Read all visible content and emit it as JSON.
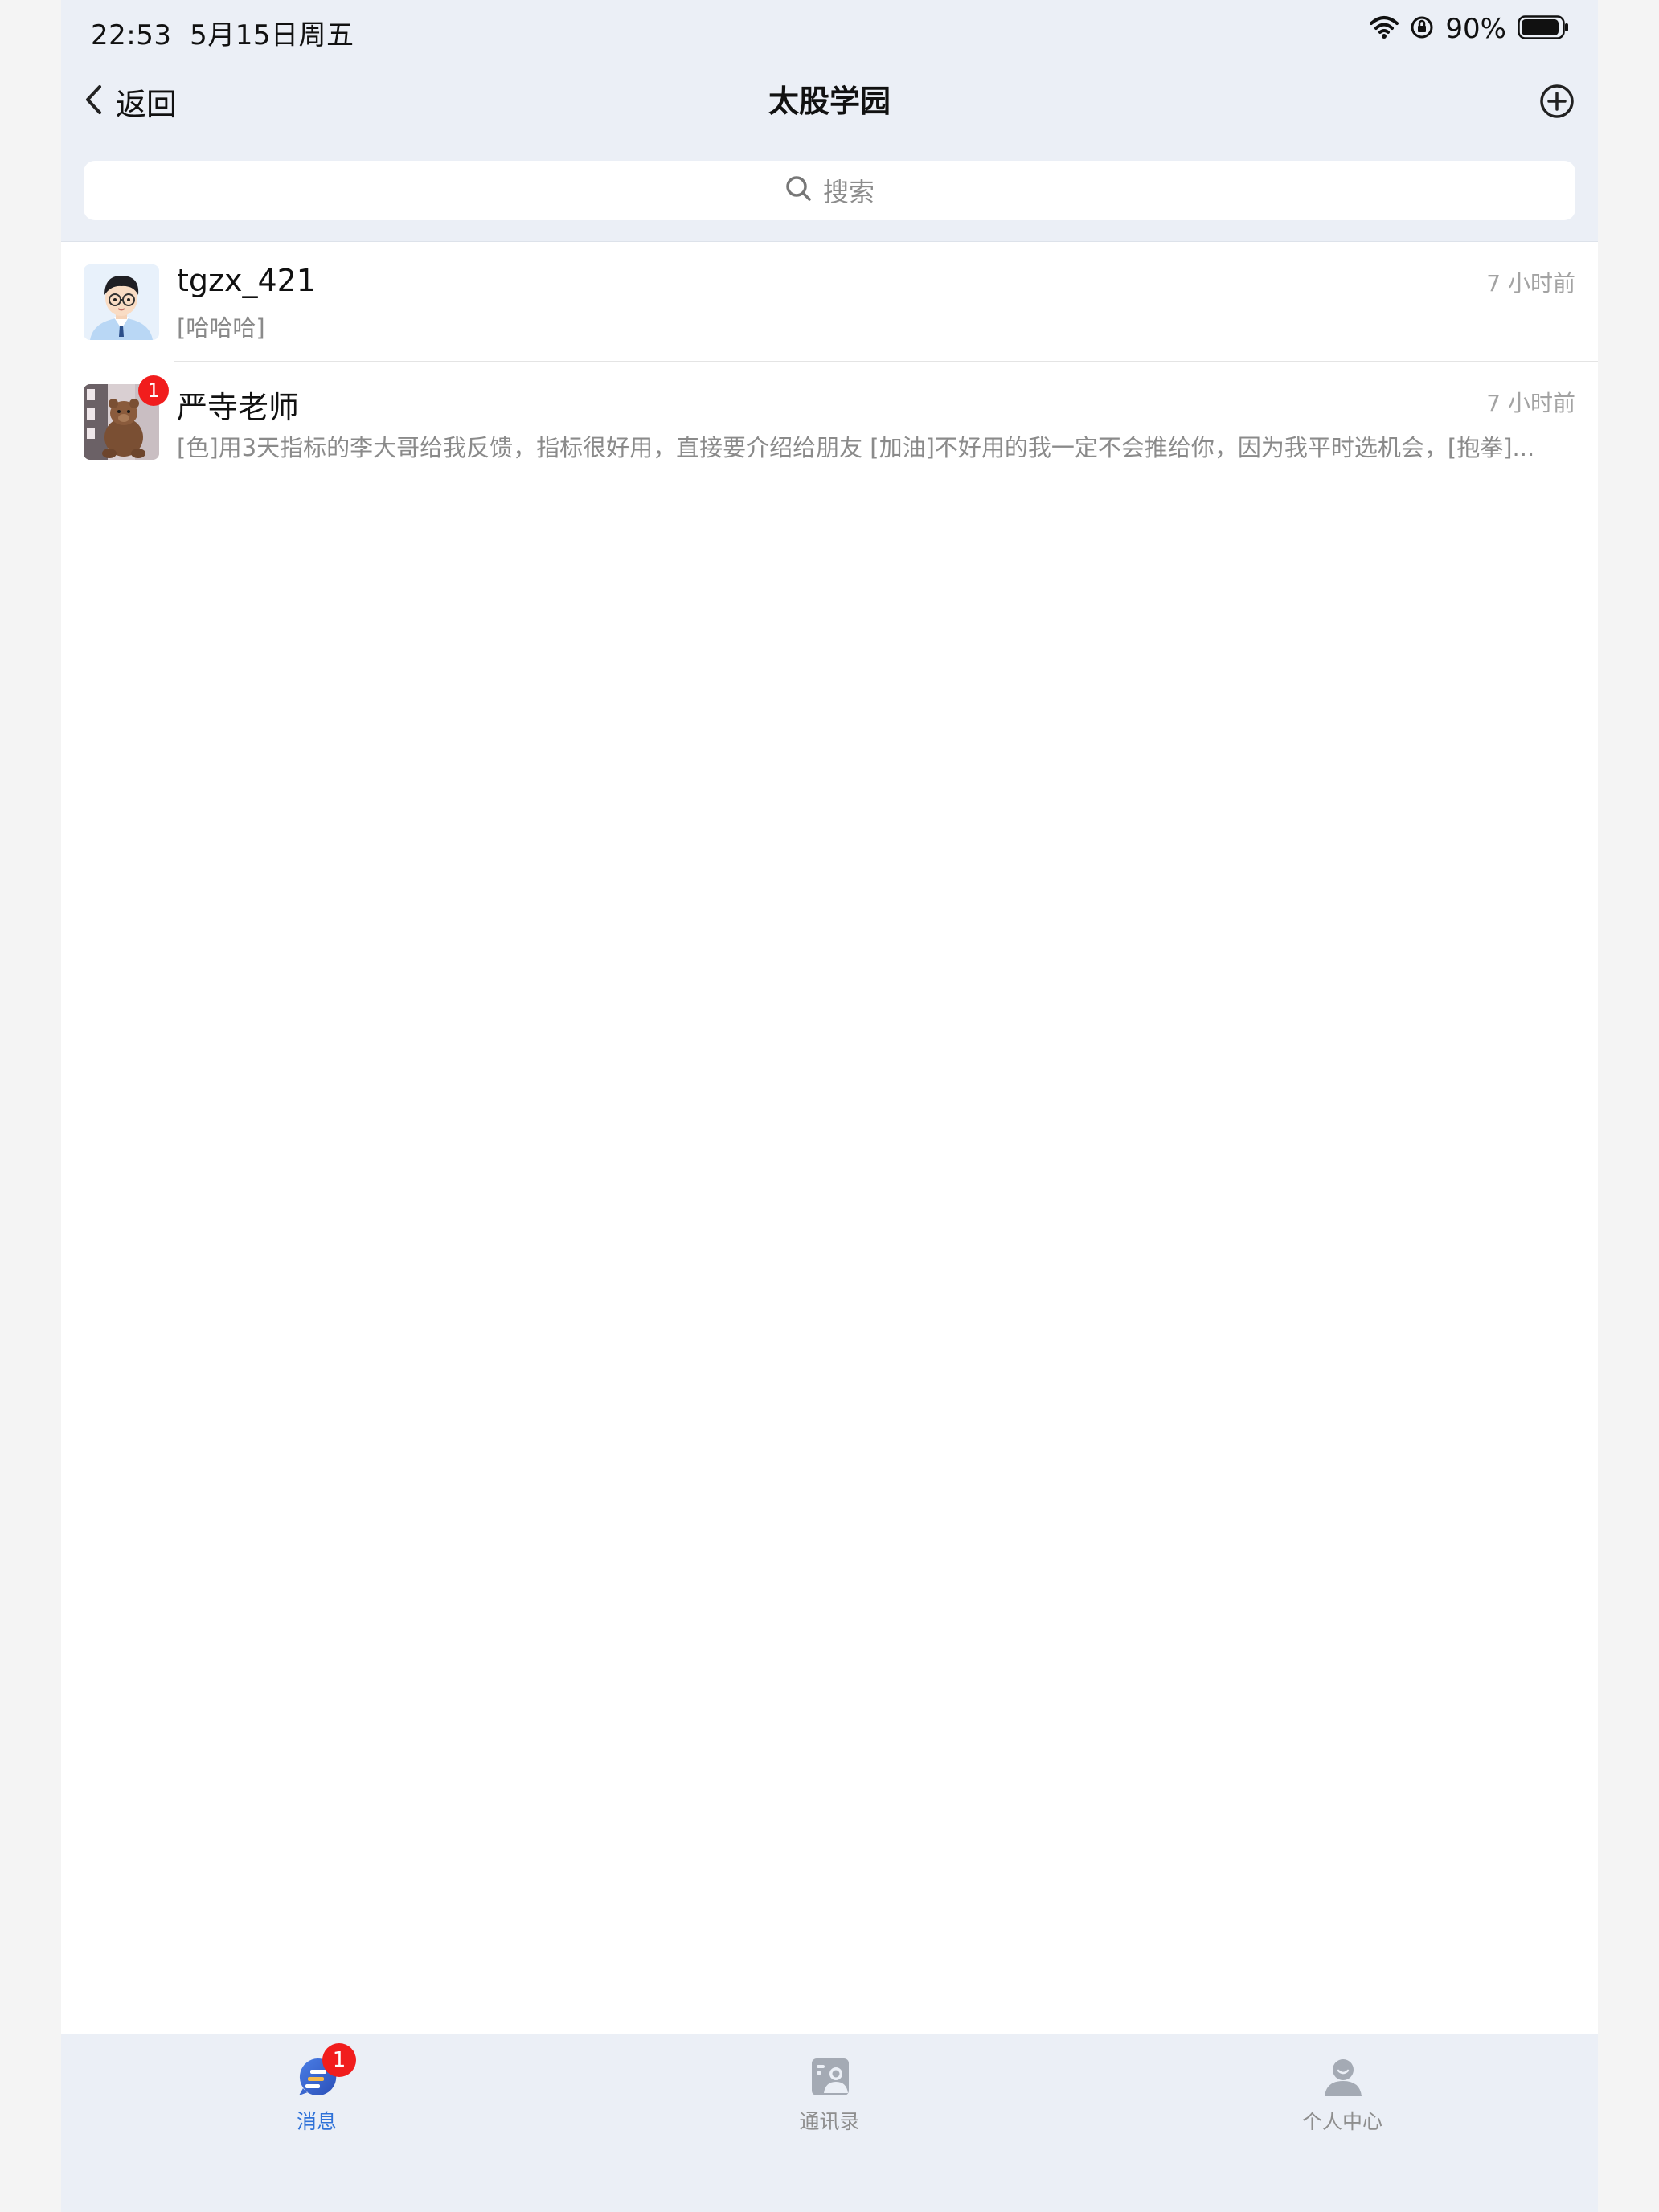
{
  "status_bar": {
    "time": "22:53",
    "date": "5月15日周五",
    "battery_percent": "90%",
    "icons": [
      "wifi-icon",
      "orientation-lock-icon",
      "battery-icon"
    ]
  },
  "nav": {
    "back_label": "返回",
    "title": "太股学园",
    "add_icon": "plus-circle-icon"
  },
  "search": {
    "placeholder": "搜索"
  },
  "conversations": [
    {
      "name": "tgzx_421",
      "time": "7 小时前",
      "message": "[哈哈哈]",
      "unread": null,
      "avatar": "cartoon-boy-avatar"
    },
    {
      "name": "严寺老师",
      "time": "7 小时前",
      "message": "[色]用3天指标的李大哥给我反馈，指标很好用，直接要介绍给朋友 [加油]不好用的我一定不会推给你，因为我平时选机会，[抱拳]...",
      "unread": "1",
      "avatar": "teddy-bear-avatar"
    }
  ],
  "tabbar": {
    "tabs": [
      {
        "label": "消息",
        "icon": "message-icon",
        "active": true,
        "badge": "1"
      },
      {
        "label": "通讯录",
        "icon": "contacts-icon",
        "active": false
      },
      {
        "label": "个人中心",
        "icon": "profile-icon",
        "active": false
      }
    ]
  },
  "colors": {
    "header_bg": "#ebeff6",
    "accent": "#2f72d8",
    "badge": "#f11d1d"
  }
}
